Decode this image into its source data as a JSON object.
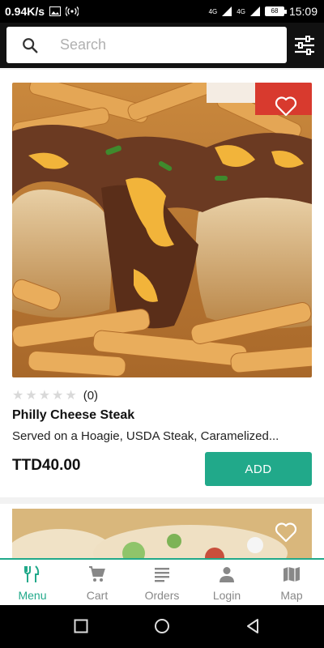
{
  "status_bar": {
    "network_speed": "0.94K/s",
    "time": "15:09",
    "battery": "68",
    "signal_labels": [
      "4G",
      "4G"
    ]
  },
  "search": {
    "placeholder": "Search"
  },
  "items": [
    {
      "rating_count": "(0)",
      "title": "Philly Cheese Steak",
      "description": "Served on a Hoagie, USDA Steak, Caramelized...",
      "price": "TTD40.00",
      "add_label": "ADD"
    }
  ],
  "bottom_nav": {
    "items": [
      {
        "label": "Menu",
        "icon": "fork-knife-icon",
        "active": true
      },
      {
        "label": "Cart",
        "icon": "cart-icon",
        "active": false
      },
      {
        "label": "Orders",
        "icon": "list-icon",
        "active": false
      },
      {
        "label": "Login",
        "icon": "person-icon",
        "active": false
      },
      {
        "label": "Map",
        "icon": "map-icon",
        "active": false
      }
    ]
  },
  "colors": {
    "accent": "#21a98a",
    "header_bg": "#111111",
    "inactive": "#888888"
  }
}
